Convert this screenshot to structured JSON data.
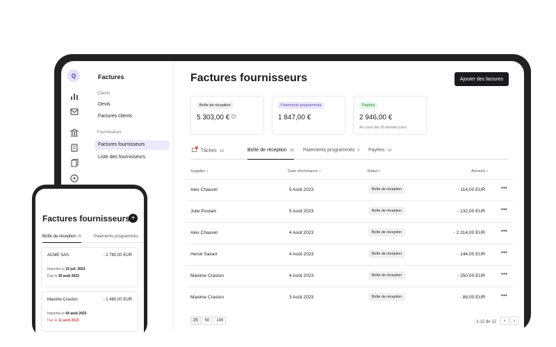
{
  "sidebar": {
    "workspace_initial": "Q",
    "app_title": "Factures",
    "section_clients": "Clients",
    "devis": "Devis",
    "factures_clients": "Factures clients",
    "section_fournisseurs": "Fournisseurs",
    "factures_fournisseurs": "Factures fournisseurs",
    "liste_fournisseurs": "Liste des fournisseurs"
  },
  "main": {
    "title": "Factures fournisseurs",
    "add_button": "Ajouter des factures",
    "kpis": [
      {
        "label": "Boîte de réception",
        "value": "5 303,00 €",
        "badge_color": "#f1f1f1"
      },
      {
        "label": "Paiements programmés",
        "value": "1 847,00 €",
        "badge_color": "#ece6fb"
      },
      {
        "label": "Payées",
        "value": "2 946,00 €",
        "note": "Au cours des 30 derniers jours",
        "badge_color": "#e2f5e6"
      }
    ],
    "tabs": [
      {
        "label": "Tâches",
        "count": "18"
      },
      {
        "label": "Boîte de réception",
        "count": "28"
      },
      {
        "label": "Paiements programmés",
        "count": "2"
      },
      {
        "label": "Payées",
        "count": "14"
      }
    ],
    "columns": {
      "supplier": "Supplier",
      "due_date": "Date d'échéance",
      "status": "Statut",
      "amount": "Amount"
    },
    "rows": [
      {
        "supplier": "Alex Chauvel",
        "date": "5 Août 2023",
        "status": "Boîte de réception",
        "amount": "- 114,00 EUR"
      },
      {
        "supplier": "Julie Poulain",
        "date": "5 Août 2023",
        "status": "Boîte de réception",
        "amount": "- 132,00 EUR"
      },
      {
        "supplier": "Alex Chauvel",
        "date": "4 Août 2023",
        "status": "Boîte de réception",
        "amount": "- 2 314,00 EUR"
      },
      {
        "supplier": "Hervé Savart",
        "date": "4 Août 2023",
        "status": "Boîte de réception",
        "amount": "- 144,00 EUR"
      },
      {
        "supplier": "Maxime Craston",
        "date": "4 Août 2023",
        "status": "Boîte de réception",
        "amount": "- 250,00 EUR"
      },
      {
        "supplier": "Maxime Craston",
        "date": "3 Août 2023",
        "status": "Boîte de réception",
        "amount": "- 88,00 EUR"
      }
    ],
    "page_sizes": [
      "25",
      "50",
      "100"
    ],
    "page_range": "1-12 de 12"
  },
  "phone": {
    "title": "Factures fournisseurs",
    "tab_inbox": "Boîte de réception",
    "tab_inbox_count": "28",
    "tab_scheduled": "Paiements programmés",
    "cards": [
      {
        "name": "ACME SAS",
        "amount": "- 2 780,00 EUR",
        "imported_label": "Importée le",
        "imported_date": "15 juil. 2023",
        "due_label": "Due le",
        "due_date": "30 août 2023"
      },
      {
        "name": "Maxime Craston",
        "amount": "- 1 480,00 EUR",
        "imported_label": "Importée le",
        "imported_date": "04 août 2023",
        "due_label": "Due le",
        "due_date": "11 août 2023"
      }
    ]
  }
}
